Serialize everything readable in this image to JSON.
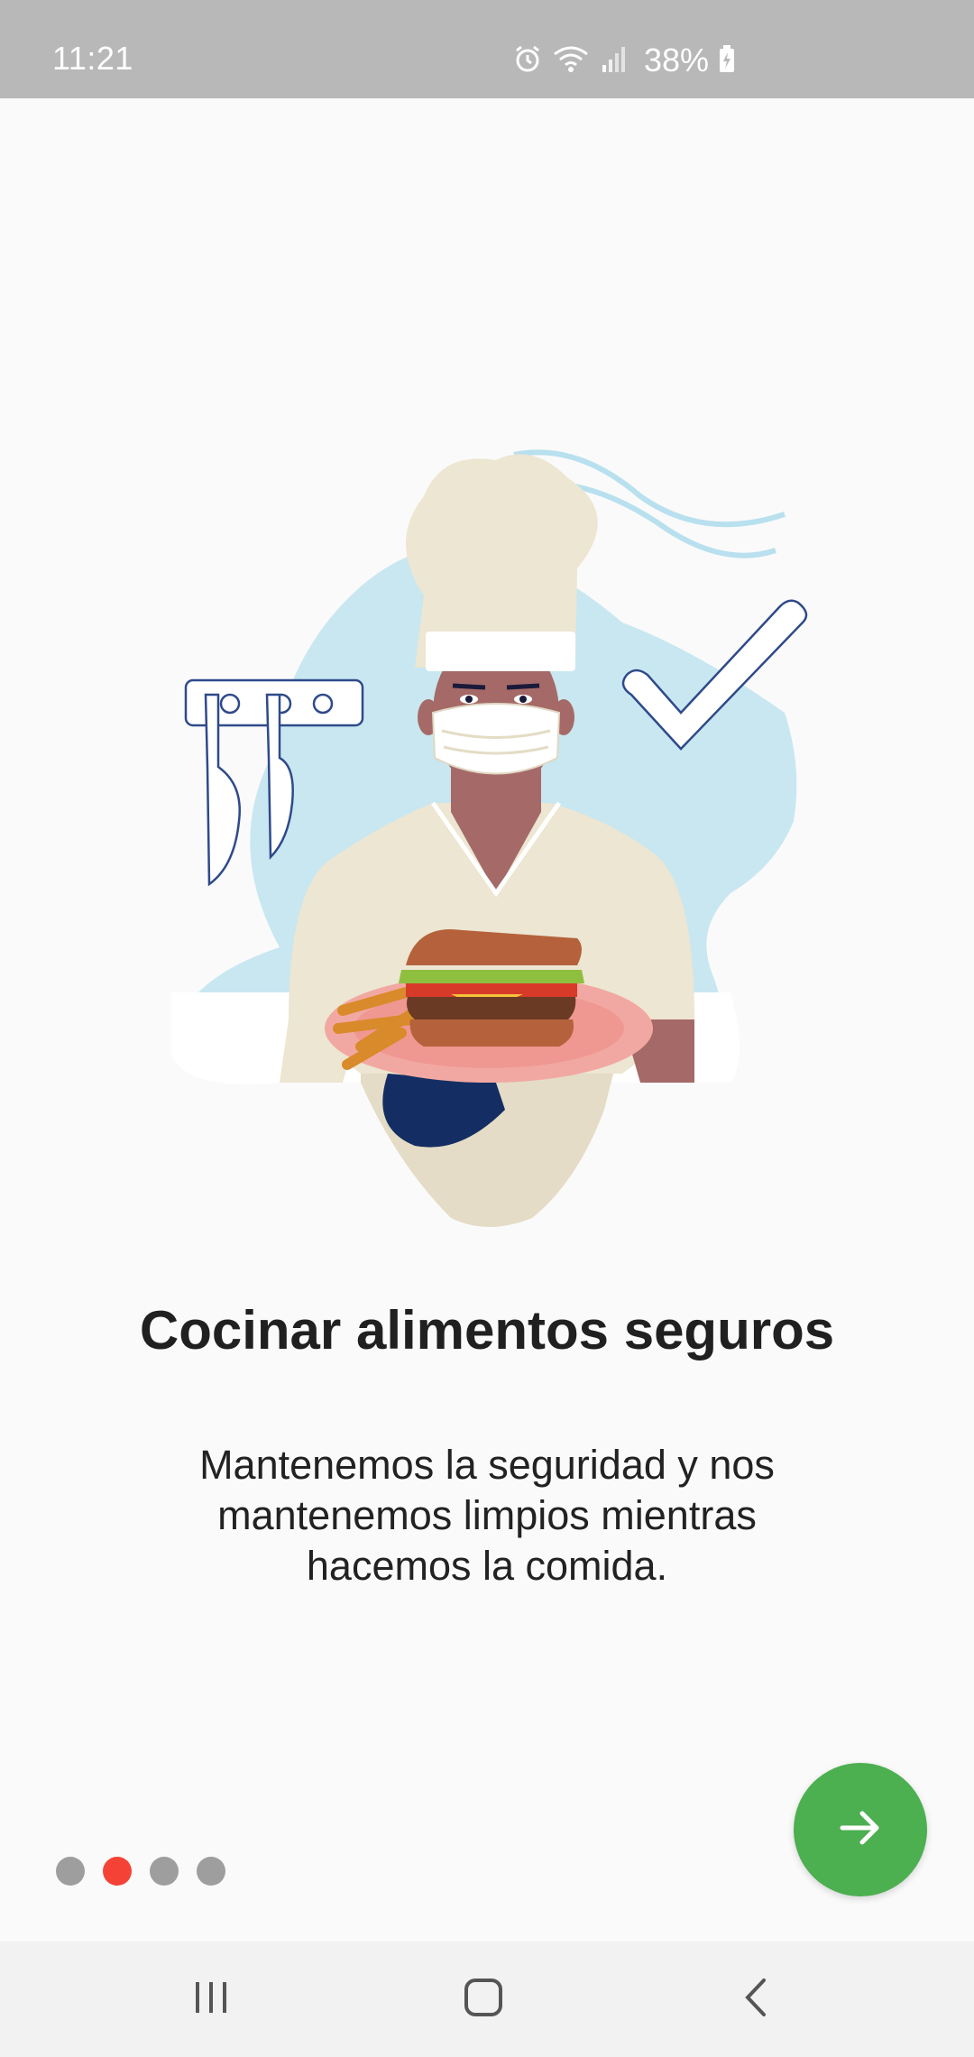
{
  "status_bar": {
    "time": "11:21",
    "battery": "38%",
    "icons": [
      "alarm-icon",
      "wifi-icon",
      "signal-icon",
      "battery-charging-icon"
    ]
  },
  "onboarding": {
    "title": "Cocinar alimentos seguros",
    "description": "Mantenemos la seguridad y nos mantenemos limpios mientras hacemos la comida.",
    "page_indicator": {
      "total": 4,
      "current": 2
    },
    "next_button_icon": "arrow-right-icon"
  },
  "nav_bar": {
    "icons": [
      "recent-apps-icon",
      "home-icon",
      "back-icon"
    ]
  },
  "colors": {
    "accent_green": "#4caf50",
    "active_dot": "#f44336",
    "inactive_dot": "#9e9e9e",
    "status_bar": "#b8b8b8"
  }
}
